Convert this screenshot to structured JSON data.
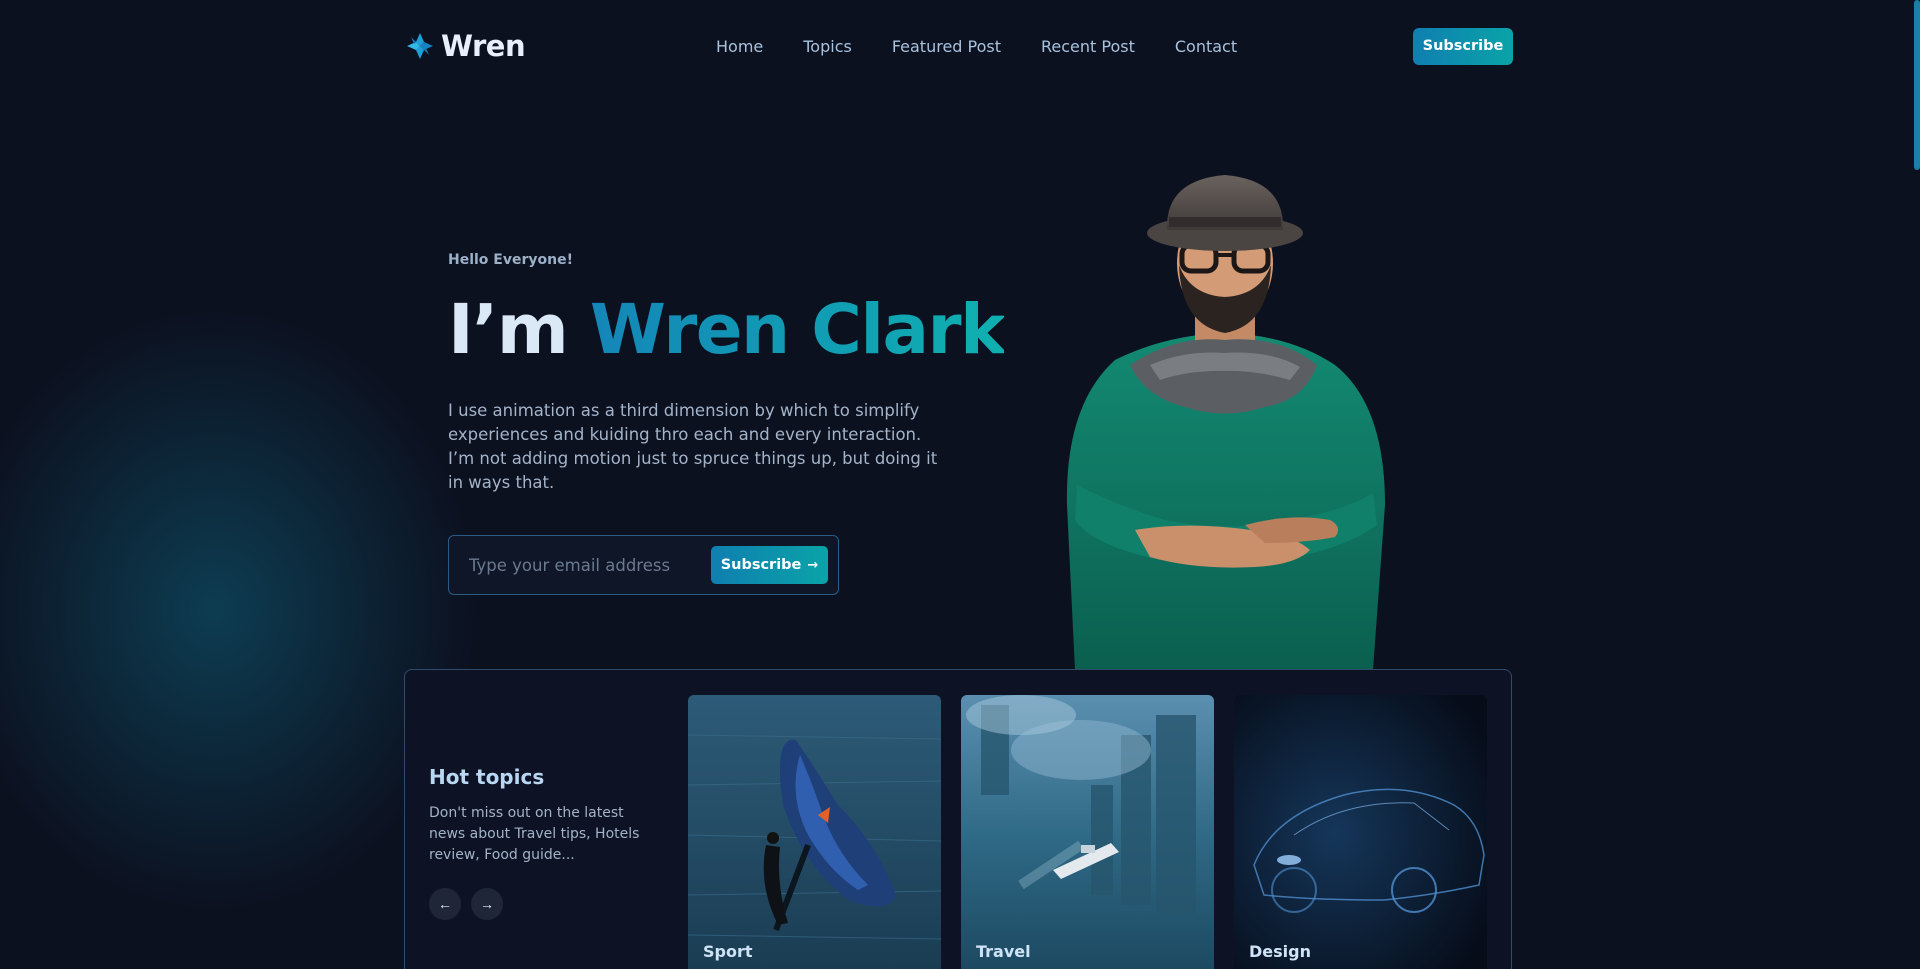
{
  "header": {
    "brand": "Wren",
    "nav": [
      "Home",
      "Topics",
      "Featured Post",
      "Recent Post",
      "Contact"
    ],
    "subscribe_label": "Subscribe"
  },
  "hero": {
    "greeting": "Hello Everyone!",
    "headline_prefix": "I’m",
    "headline_name": "Wren Clark",
    "intro": "I use animation as a third dimension by which to simplify experiences and kuiding thro each and every interaction. I’m not adding motion just to spruce things up, but doing it in ways that.",
    "email_placeholder": "Type your email address",
    "email_value": "",
    "subscribe_label": "Subscribe",
    "subscribe_icon": "arrow-right-icon"
  },
  "topics": {
    "title": "Hot topics",
    "description": "Don't miss out on the latest news about Travel tips, Hotels review, Food guide...",
    "prev_icon": "arrow-left-icon",
    "next_icon": "arrow-right-icon",
    "cards": [
      {
        "label": "Sport"
      },
      {
        "label": "Travel"
      },
      {
        "label": "Design"
      }
    ]
  },
  "colors": {
    "background": "#0c1120",
    "accent_start": "#1486b8",
    "accent_end": "#0fb0b0",
    "nav_text": "#a9c2dd"
  }
}
